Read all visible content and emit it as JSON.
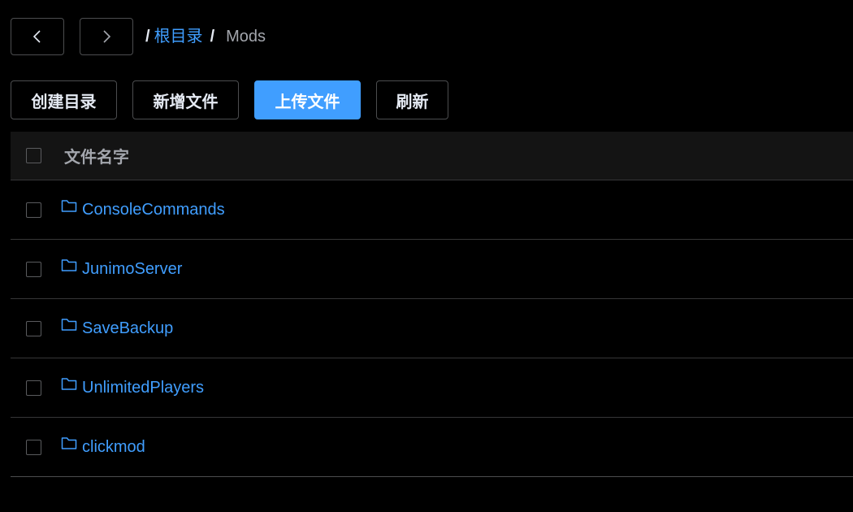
{
  "nav": {
    "back_icon": "chevron-left-icon",
    "forward_icon": "chevron-right-icon"
  },
  "breadcrumb": {
    "root_sep": "/",
    "root_label": "根目录",
    "sep": "/",
    "current": "Mods"
  },
  "toolbar": {
    "create_dir": "创建目录",
    "new_file": "新增文件",
    "upload_file": "上传文件",
    "refresh": "刷新"
  },
  "table": {
    "header_name": "文件名字",
    "rows": [
      {
        "name": "ConsoleCommands",
        "icon": "folder-icon"
      },
      {
        "name": "JunimoServer",
        "icon": "folder-icon"
      },
      {
        "name": "SaveBackup",
        "icon": "folder-icon"
      },
      {
        "name": "UnlimitedPlayers",
        "icon": "folder-icon"
      },
      {
        "name": "clickmod",
        "icon": "folder-icon"
      }
    ]
  },
  "colors": {
    "accent": "#409eff",
    "background": "#000000",
    "header_bg": "#141414",
    "border": "#4c4d4f"
  }
}
